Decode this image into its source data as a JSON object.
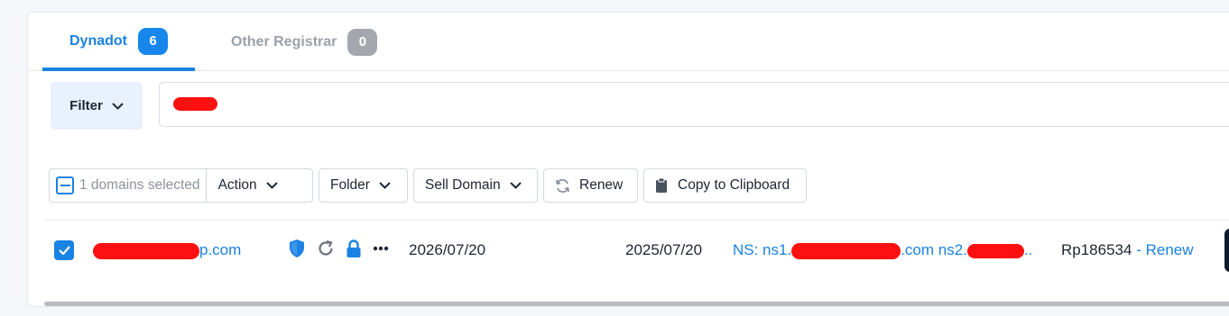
{
  "tabs": [
    {
      "label": "Dynadot",
      "count": "6"
    },
    {
      "label": "Other Registrar",
      "count": "0"
    }
  ],
  "filter": {
    "label": "Filter"
  },
  "toolbar": {
    "selected_text": "1 domains selected",
    "action_label": "Action",
    "folder_label": "Folder",
    "sell_label": "Sell Domain",
    "renew_label": "Renew",
    "copy_label": "Copy to Clipboard"
  },
  "row": {
    "domain_suffix": "p.com",
    "expiry": "2026/07/20",
    "registered": "2025/07/20",
    "ns_prefix": "NS: ns1.",
    "ns_mid": ".com ns2.",
    "ns_end": "..",
    "price": "Rp186534",
    "separator": "-",
    "renew_link": "Renew"
  },
  "colors": {
    "accent": "#1a82e2",
    "redaction": "#ff1010",
    "badge_grey": "#a4a8ae"
  },
  "icons": [
    "shield-icon",
    "refresh-icon",
    "lock-icon",
    "more-icon",
    "chevron-down-icon",
    "copy-icon",
    "check-icon"
  ]
}
